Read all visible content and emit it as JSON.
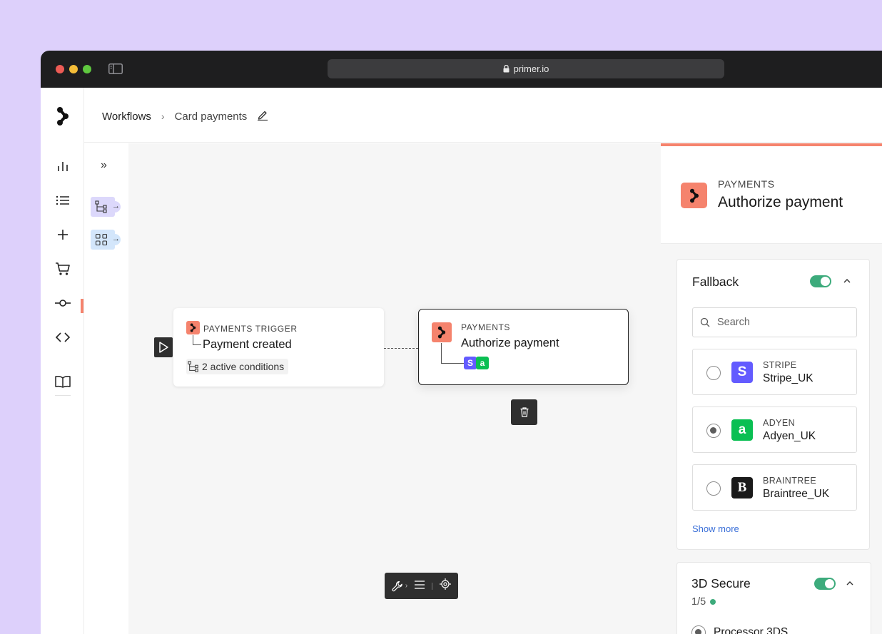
{
  "browser": {
    "url": "primer.io"
  },
  "breadcrumb": {
    "root": "Workflows",
    "separator": "›",
    "current": "Card payments"
  },
  "nav": {
    "items": [
      "chart-icon",
      "list-icon",
      "plus-icon",
      "cart-icon",
      "commit-icon",
      "code-icon",
      "book-icon"
    ],
    "active": "cart-icon"
  },
  "canvas": {
    "expand_label": "»",
    "trigger_node": {
      "kicker": "PAYMENTS TRIGGER",
      "title": "Payment created",
      "conditions": "2 active conditions"
    },
    "action_node": {
      "kicker": "PAYMENTS",
      "title": "Authorize payment"
    }
  },
  "panel": {
    "kicker": "PAYMENTS",
    "title": "Authorize payment",
    "fallback": {
      "title": "Fallback",
      "enabled": true,
      "search_placeholder": "Search",
      "processors": [
        {
          "kicker": "STRIPE",
          "name": "Stripe_UK",
          "selected": false,
          "logo_letter": "S",
          "color": "#635bff"
        },
        {
          "kicker": "ADYEN",
          "name": "Adyen_UK",
          "selected": true,
          "logo_letter": "a",
          "color": "#0abf53"
        },
        {
          "kicker": "BRAINTREE",
          "name": "Braintree_UK",
          "selected": false,
          "logo_letter": "B",
          "color": "#1a1a1a"
        }
      ],
      "show_more": "Show more"
    },
    "three_ds": {
      "title": "3D Secure",
      "enabled": true,
      "count": "1/5",
      "option": "Processor 3DS"
    }
  },
  "colors": {
    "accent": "#f5836d",
    "toggle_on": "#3dab7c",
    "link": "#3a6fd8",
    "background": "#ddd0fb"
  }
}
